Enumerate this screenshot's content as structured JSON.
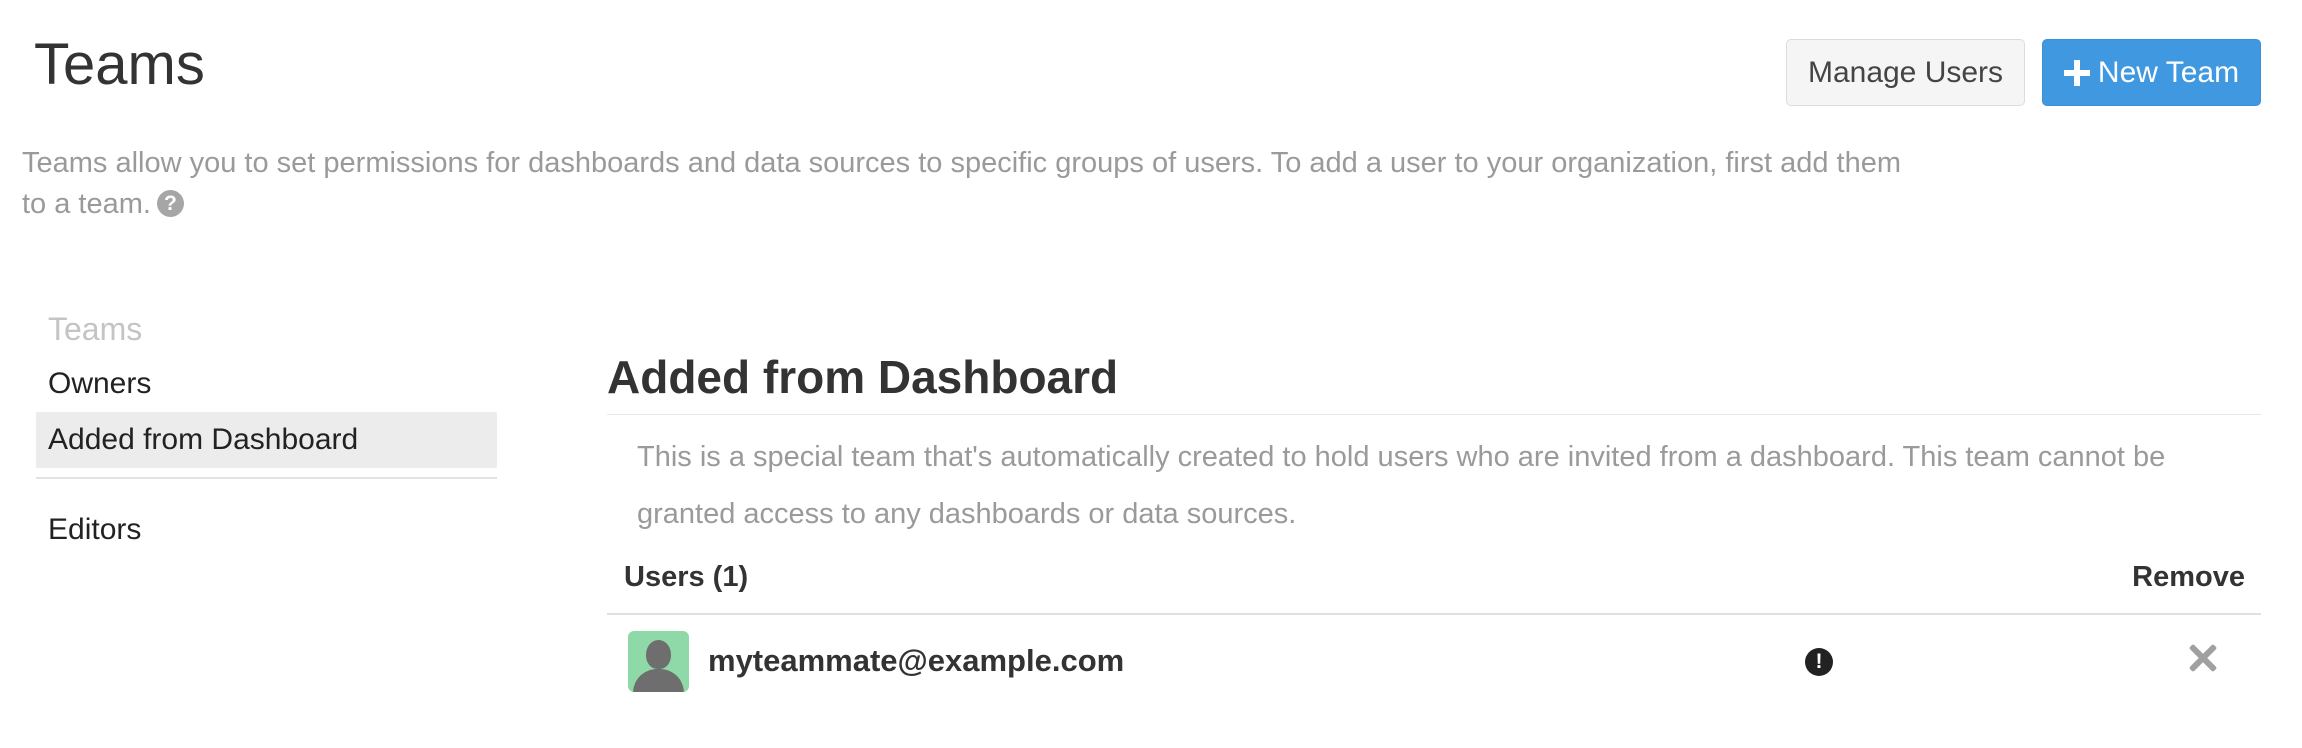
{
  "header": {
    "title": "Teams",
    "manage_users_label": "Manage Users",
    "new_team_label": "New Team"
  },
  "intro": {
    "text": "Teams allow you to set permissions for dashboards and data sources to specific groups of users. To add a user to your organization, first add them to a team.",
    "help_icon": "question-circle-icon"
  },
  "sidebar": {
    "heading": "Teams",
    "items": [
      {
        "label": "Owners",
        "active": false
      },
      {
        "label": "Added from Dashboard",
        "active": true
      },
      {
        "label": "Editors",
        "active": false
      }
    ]
  },
  "main": {
    "title": "Added from Dashboard",
    "description": "This is a special team that's automatically created to hold users who are invited from a dashboard. This team cannot be granted access to any dashboards or data sources.",
    "table": {
      "users_header": "Users (1)",
      "remove_header": "Remove",
      "rows": [
        {
          "email": "myteammate@example.com",
          "avatar_icon": "user-silhouette-icon",
          "status_icon": "exclamation-circle-icon",
          "remove_icon": "close-icon"
        }
      ]
    }
  },
  "colors": {
    "primary": "#3f98e0",
    "avatar_bg": "#8fd9a8",
    "muted_text": "#9a9a9a",
    "active_item_bg": "#ececec"
  }
}
